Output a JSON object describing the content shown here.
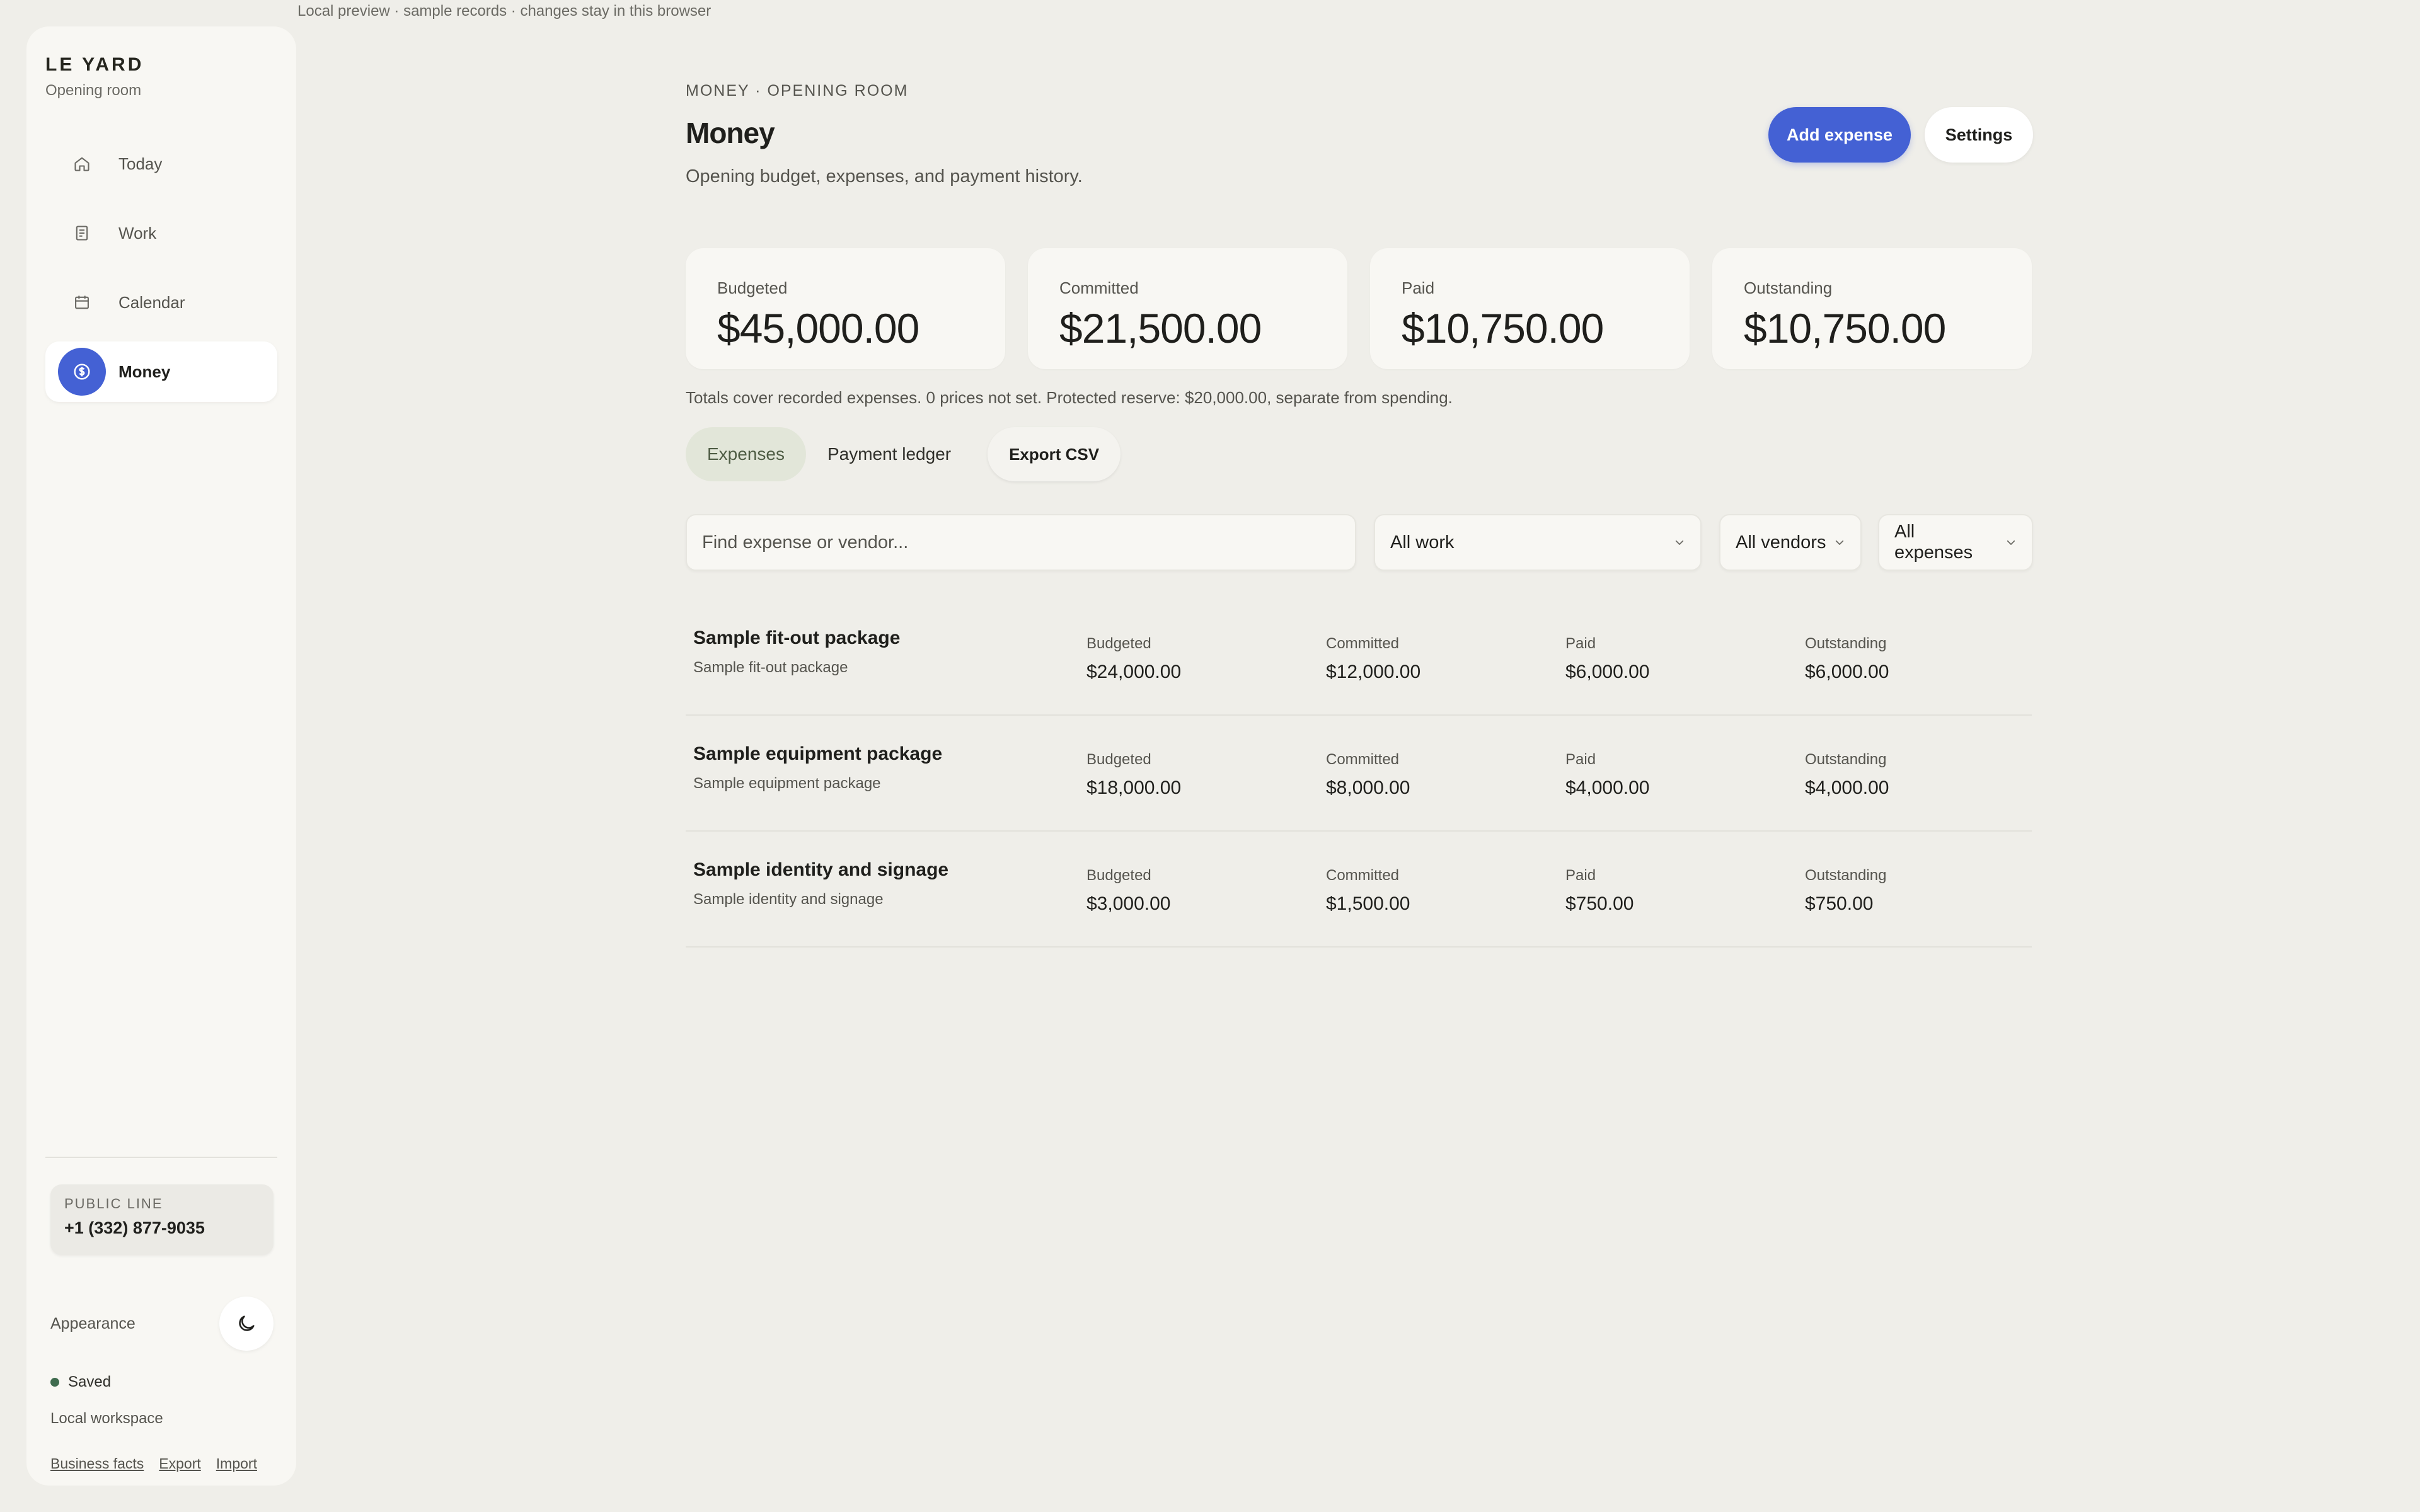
{
  "preview_note": "Local preview · sample records · changes stay in this browser",
  "sidebar": {
    "brand": "LE YARD",
    "brand_sub": "Opening room",
    "nav": [
      {
        "label": "Today",
        "icon": "home-icon"
      },
      {
        "label": "Work",
        "icon": "document-icon"
      },
      {
        "label": "Calendar",
        "icon": "calendar-icon"
      },
      {
        "label": "Money",
        "icon": "dollar-circle-icon",
        "active": true
      }
    ],
    "public_line_label": "PUBLIC LINE",
    "public_line_value": "+1 (332) 877-9035",
    "appearance_label": "Appearance",
    "appearance_icon": "moon-icon",
    "saved_label": "Saved",
    "workspace_label": "Local workspace",
    "links": [
      "Business facts",
      "Export",
      "Import"
    ]
  },
  "header": {
    "eyebrow": "MONEY · OPENING ROOM",
    "title": "Money",
    "subtitle": "Opening budget, expenses, and payment history.",
    "add_button": "Add expense",
    "settings_button": "Settings"
  },
  "summary": [
    {
      "label": "Budgeted",
      "value": "$45,000.00"
    },
    {
      "label": "Committed",
      "value": "$21,500.00"
    },
    {
      "label": "Paid",
      "value": "$10,750.00"
    },
    {
      "label": "Outstanding",
      "value": "$10,750.00"
    }
  ],
  "totals_note": "Totals cover recorded expenses. 0 prices not set. Protected reserve: $20,000.00, separate from spending.",
  "tabs": {
    "expenses": "Expenses",
    "ledger": "Payment ledger",
    "export": "Export CSV"
  },
  "filters": {
    "search_placeholder": "Find expense or vendor...",
    "work": "All work",
    "vendors": "All vendors",
    "expenses": "All expenses"
  },
  "expenses": [
    {
      "title": "Sample fit-out package",
      "subtitle": "Sample fit-out package",
      "budgeted_label": "Budgeted",
      "budgeted": "$24,000.00",
      "committed_label": "Committed",
      "committed": "$12,000.00",
      "paid_label": "Paid",
      "paid": "$6,000.00",
      "outstanding_label": "Outstanding",
      "outstanding": "$6,000.00"
    },
    {
      "title": "Sample equipment package",
      "subtitle": "Sample equipment package",
      "budgeted_label": "Budgeted",
      "budgeted": "$18,000.00",
      "committed_label": "Committed",
      "committed": "$8,000.00",
      "paid_label": "Paid",
      "paid": "$4,000.00",
      "outstanding_label": "Outstanding",
      "outstanding": "$4,000.00"
    },
    {
      "title": "Sample identity and signage",
      "subtitle": "Sample identity and signage",
      "budgeted_label": "Budgeted",
      "budgeted": "$3,000.00",
      "committed_label": "Committed",
      "committed": "$1,500.00",
      "paid_label": "Paid",
      "paid": "$750.00",
      "outstanding_label": "Outstanding",
      "outstanding": "$750.00"
    }
  ],
  "colors": {
    "accent": "#4461d4",
    "background": "#efeee9",
    "panel": "#f8f7f3",
    "active_tab": "#e2e6d9",
    "saved_dot": "#3f6b4e"
  }
}
